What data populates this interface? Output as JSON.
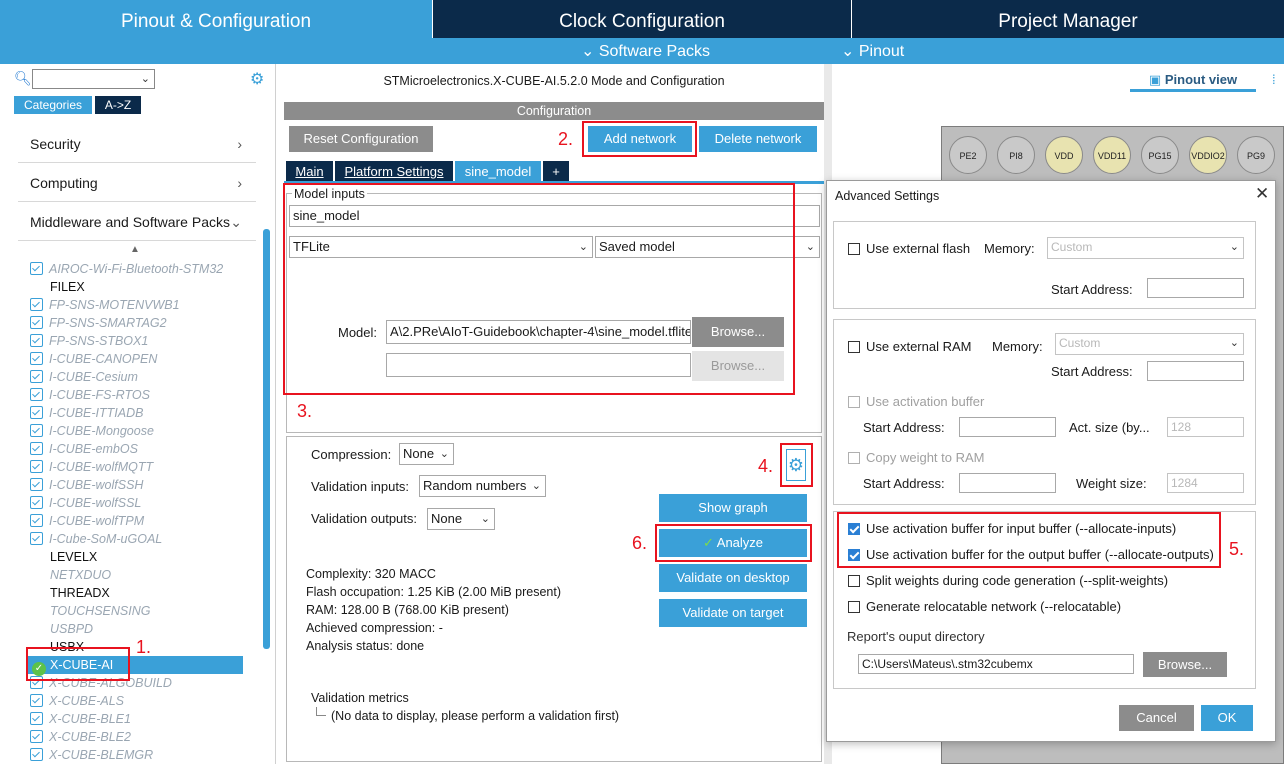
{
  "top_tabs": [
    "Pinout & Configuration",
    "Clock Configuration",
    "Project Manager"
  ],
  "subbar": {
    "software_packs": "Software Packs",
    "pinout": "Pinout"
  },
  "left": {
    "search_placeholder": "",
    "categories_label": "Categories",
    "az_label": "A->Z",
    "category_rows": [
      "Security",
      "Computing",
      "Middleware and Software Packs"
    ],
    "items": [
      "AIROC-Wi-Fi-Bluetooth-STM32",
      "FILEX",
      "FP-SNS-MOTENVWB1",
      "FP-SNS-SMARTAG2",
      "FP-SNS-STBOX1",
      "I-CUBE-CANOPEN",
      "I-CUBE-Cesium",
      "I-CUBE-FS-RTOS",
      "I-CUBE-ITTIADB",
      "I-CUBE-Mongoose",
      "I-CUBE-embOS",
      "I-CUBE-wolfMQTT",
      "I-CUBE-wolfSSH",
      "I-CUBE-wolfSSL",
      "I-CUBE-wolfTPM",
      "I-Cube-SoM-uGOAL",
      "LEVELX",
      "NETXDUO",
      "THREADX",
      "TOUCHSENSING",
      "USBPD",
      "USBX",
      "X-CUBE-AI",
      "X-CUBE-ALGOBUILD",
      "X-CUBE-ALS",
      "X-CUBE-BLE1",
      "X-CUBE-BLE2",
      "X-CUBE-BLEMGR"
    ]
  },
  "mid": {
    "title": "STMicroelectronics.X-CUBE-AI.5.2.0 Mode and Configuration",
    "config_header": "Configuration",
    "reset_btn": "Reset Configuration",
    "add_btn": "Add network",
    "delete_btn": "Delete network",
    "tabs": [
      "Main",
      "Platform Settings",
      "sine_model",
      "+"
    ],
    "model_inputs_legend": "Model inputs",
    "model_name": "sine_model",
    "framework": "TFLite",
    "model_type": "Saved model",
    "model_label": "Model:",
    "model_path": "A\\2.PRe\\AIoT-Guidebook\\chapter-4\\sine_model.tflite",
    "browse": "Browse...",
    "compression_label": "Compression:",
    "compression_value": "None",
    "val_inputs_label": "Validation inputs:",
    "val_inputs_value": "Random numbers",
    "val_outputs_label": "Validation outputs:",
    "val_outputs_value": "None",
    "show_graph": "Show graph",
    "analyze": "Analyze",
    "validate_desktop": "Validate on desktop",
    "validate_target": "Validate on target",
    "complexity": "Complexity:  320 MACC",
    "flash": "Flash occupation: 1.25 KiB (2.00 MiB present)",
    "ram": "RAM: 128.00 B (768.00 KiB present)",
    "achieved": "Achieved compression: -",
    "status": "Analysis status: done",
    "val_metrics": "Validation metrics",
    "no_data": "(No data to display, please perform a validation first)"
  },
  "right": {
    "pinout_view": "Pinout view",
    "chips": [
      "PE2",
      "PI8",
      "VDD",
      "VDD11",
      "PG15",
      "VDDIO2",
      "PG9"
    ]
  },
  "dialog": {
    "title": "Advanced Settings",
    "ext_flash": "Use external flash",
    "memory_label": "Memory:",
    "memory_value": "Custom",
    "start_address": "Start Address:",
    "ext_ram": "Use external RAM",
    "use_act_buf": "Use activation buffer",
    "act_size": "Act. size (by...",
    "act_size_value": "128",
    "copy_weight": "Copy weight to RAM",
    "weight_size": "Weight size:",
    "weight_size_value": "1284",
    "opt_inputs": "Use activation buffer for input buffer (--allocate-inputs)",
    "opt_outputs": "Use activation buffer for the output buffer (--allocate-outputs)",
    "opt_split": "Split weights during code generation (--split-weights)",
    "opt_reloc": "Generate relocatable network (--relocatable)",
    "report_dir_label": "Report's ouput directory",
    "report_dir": "C:\\Users\\Mateus\\.stm32cubemx",
    "browse": "Browse...",
    "cancel": "Cancel",
    "ok": "OK"
  },
  "annotations": [
    "1.",
    "2.",
    "3.",
    "4.",
    "5.",
    "6."
  ],
  "colors": {
    "tab_active": "#3aa0d8",
    "tab_dark": "#0b2a4a",
    "annotation": "#e8131f"
  }
}
